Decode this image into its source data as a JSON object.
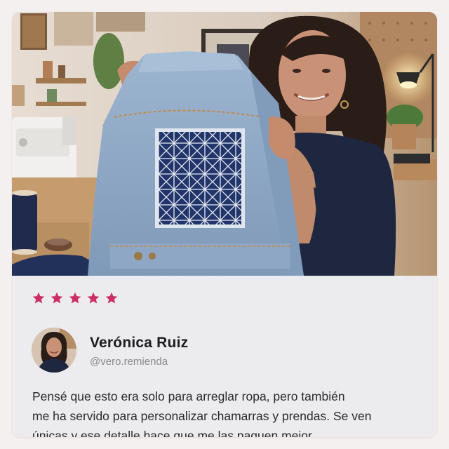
{
  "photo": {
    "description_icon": "photo-icon",
    "alt": ""
  },
  "review": {
    "rating": 5,
    "rating_max": 5,
    "star_color": "#cc2f68",
    "reviewer": {
      "name": "Verónica Ruiz",
      "handle": "@vero.remienda"
    },
    "quote_lines": [
      "Pensé que esto era solo para arreglar ropa, pero también",
      "me ha servido para personalizar chamarras y prendas. Se ven",
      "únicas y ese detalle hace que me las paguen mejor."
    ]
  },
  "colors": {
    "page_background": "#f5f0f0",
    "card_background": "#ececee",
    "name_text": "#1d1d1f",
    "handle_text": "#8a8a8e",
    "denim": "#8fa9c7",
    "sashiko_blue": "#22356b"
  }
}
